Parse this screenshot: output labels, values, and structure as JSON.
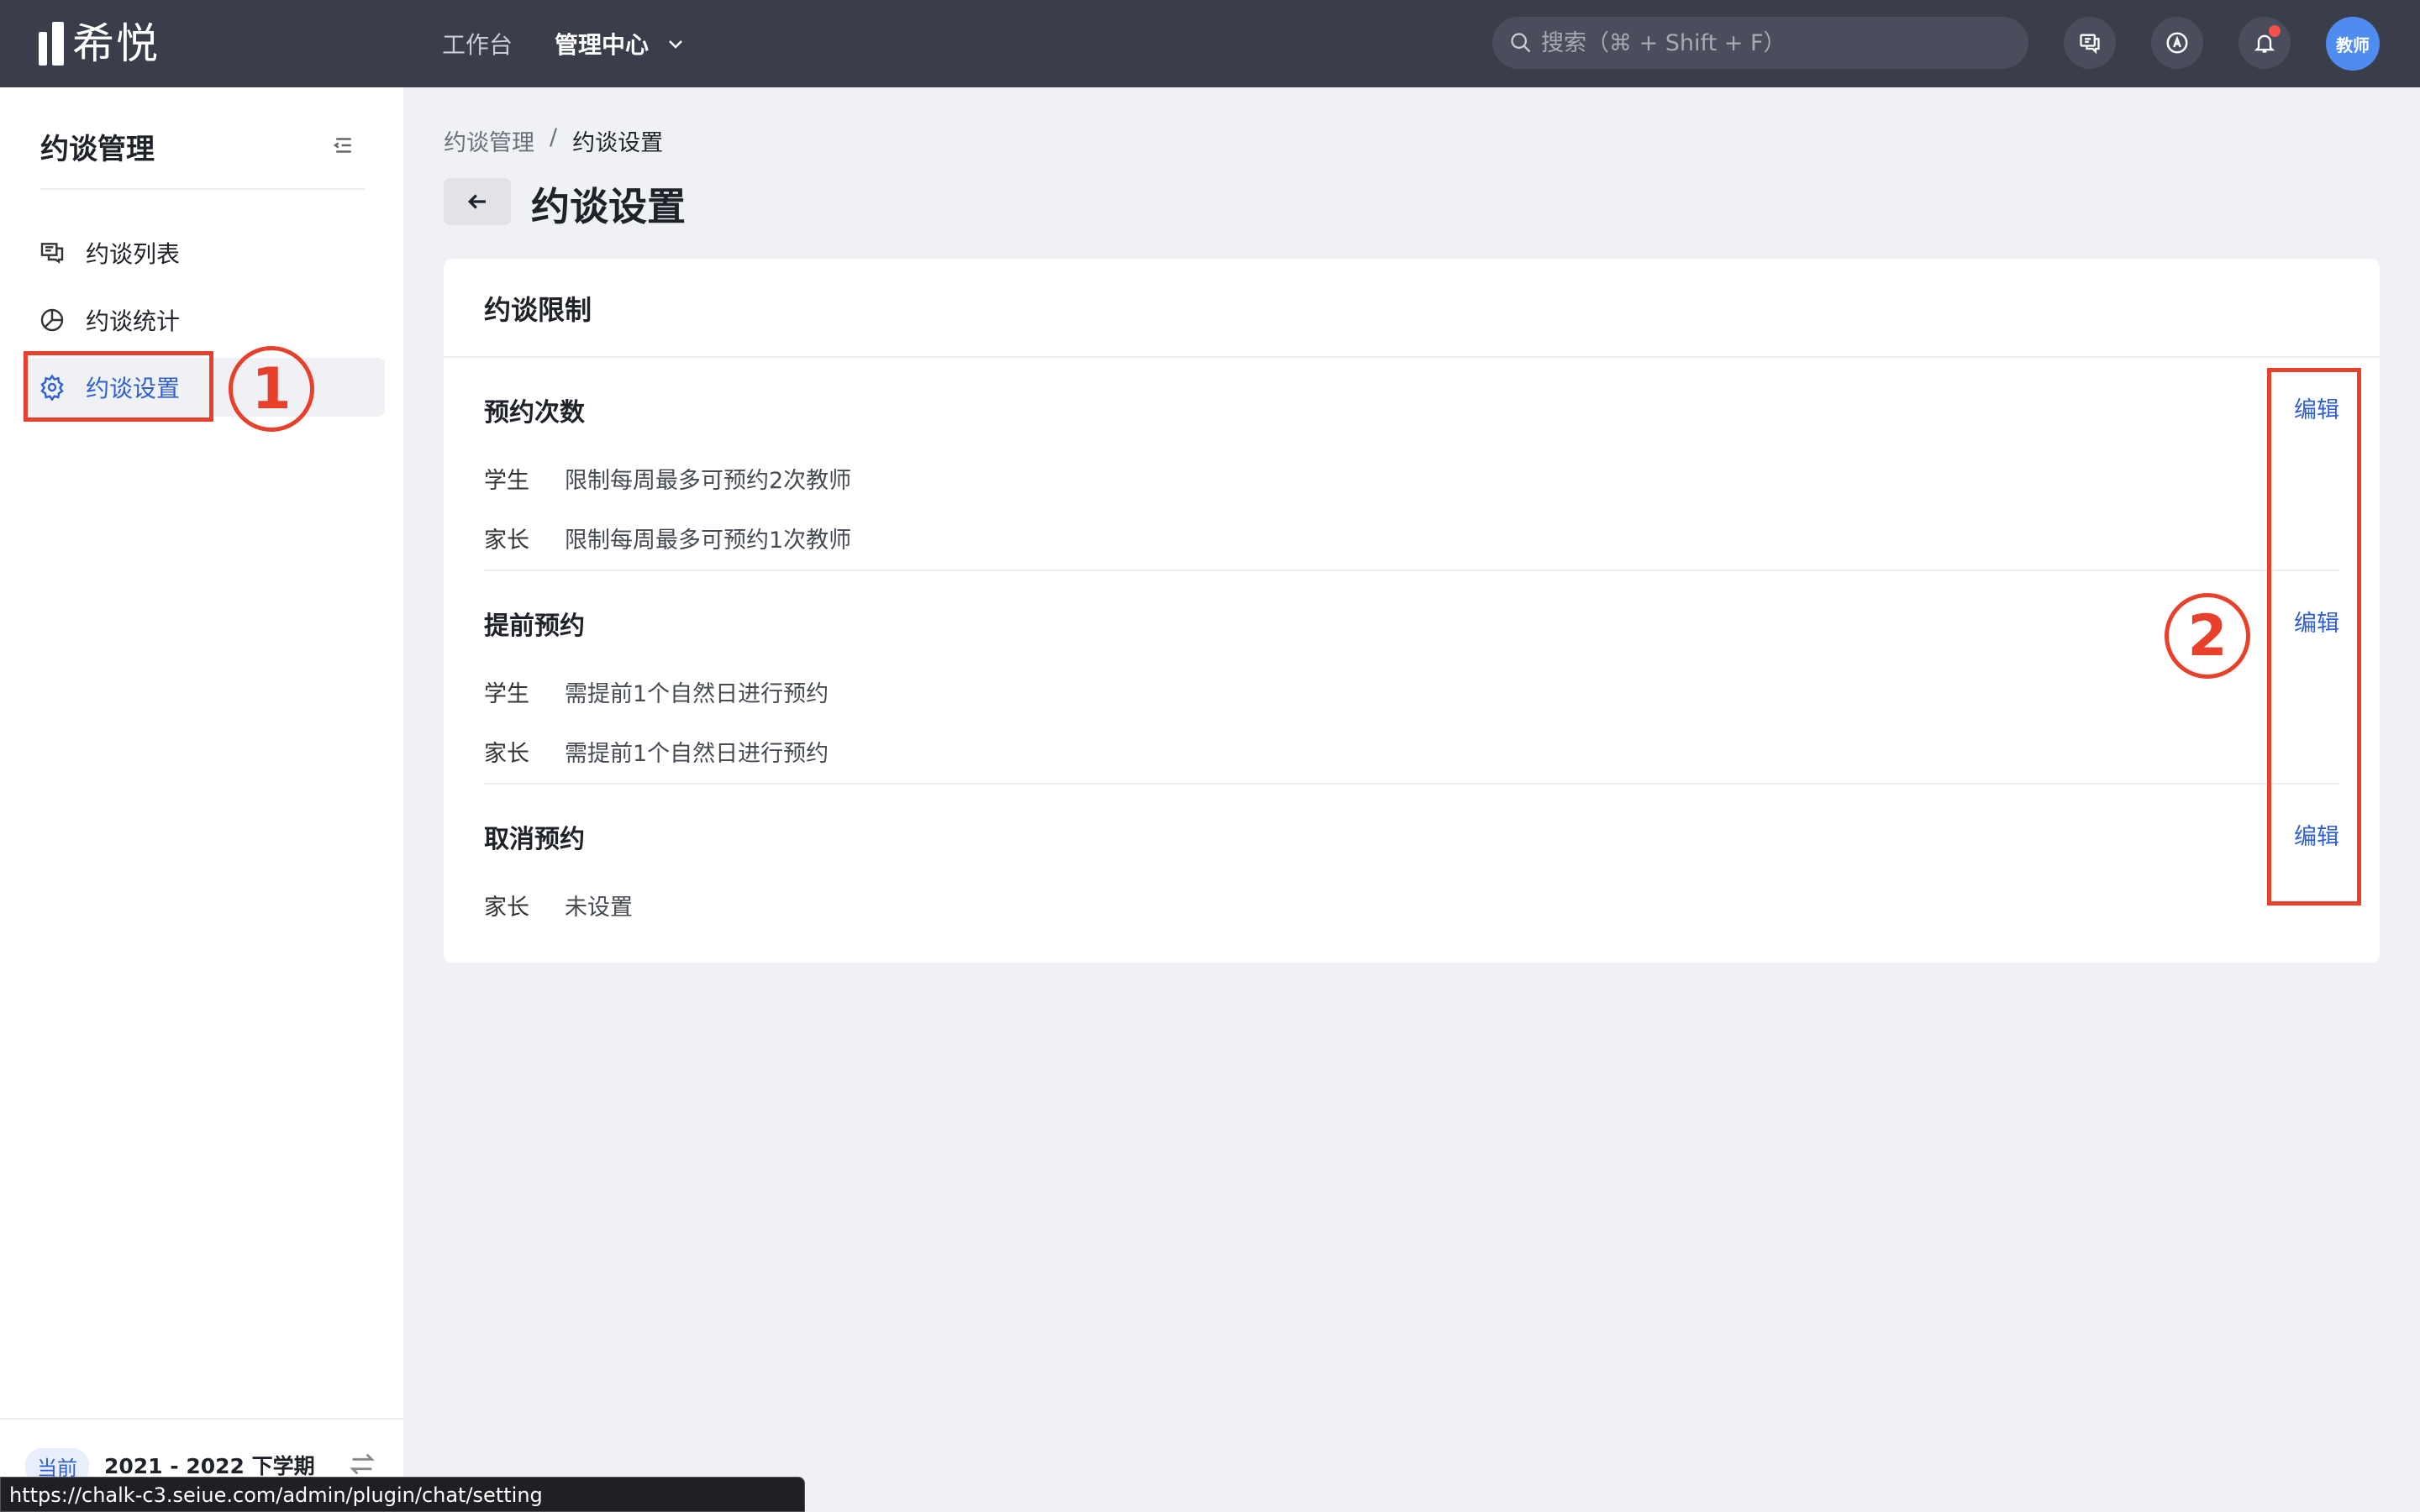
{
  "app": {
    "logo_text": "希悦"
  },
  "topnav": {
    "items": [
      "工作台",
      "管理中心"
    ]
  },
  "search": {
    "placeholder": "搜索（⌘ + Shift + F）"
  },
  "user": {
    "avatar_text": "教师"
  },
  "sidebar": {
    "title": "约谈管理",
    "items": [
      {
        "label": "约谈列表",
        "icon": "message-list-icon"
      },
      {
        "label": "约谈统计",
        "icon": "pie-chart-icon"
      },
      {
        "label": "约谈设置",
        "icon": "gear-icon",
        "active": true
      }
    ],
    "term_badge": "当前",
    "term": "2021 - 2022 下学期"
  },
  "status_url": "https://chalk-c3.seiue.com/admin/plugin/chat/setting",
  "breadcrumb": [
    "约谈管理",
    "/",
    "约谈设置"
  ],
  "page_title": "约谈设置",
  "card": {
    "title": "约谈限制",
    "sections": [
      {
        "title": "预约次数",
        "edit": "编辑",
        "rows": [
          {
            "label": "学生",
            "value": "限制每周最多可预约2次教师"
          },
          {
            "label": "家长",
            "value": "限制每周最多可预约1次教师"
          }
        ]
      },
      {
        "title": "提前预约",
        "edit": "编辑",
        "rows": [
          {
            "label": "学生",
            "value": "需提前1个自然日进行预约"
          },
          {
            "label": "家长",
            "value": "需提前1个自然日进行预约"
          }
        ]
      },
      {
        "title": "取消预约",
        "edit": "编辑",
        "rows": [
          {
            "label": "家长",
            "value": "未设置"
          }
        ]
      }
    ]
  },
  "annotations": [
    "1",
    "2"
  ],
  "colors": {
    "accent": "#2f5fd1",
    "annotation": "#e8402b",
    "topbar": "#3a3d4a"
  }
}
